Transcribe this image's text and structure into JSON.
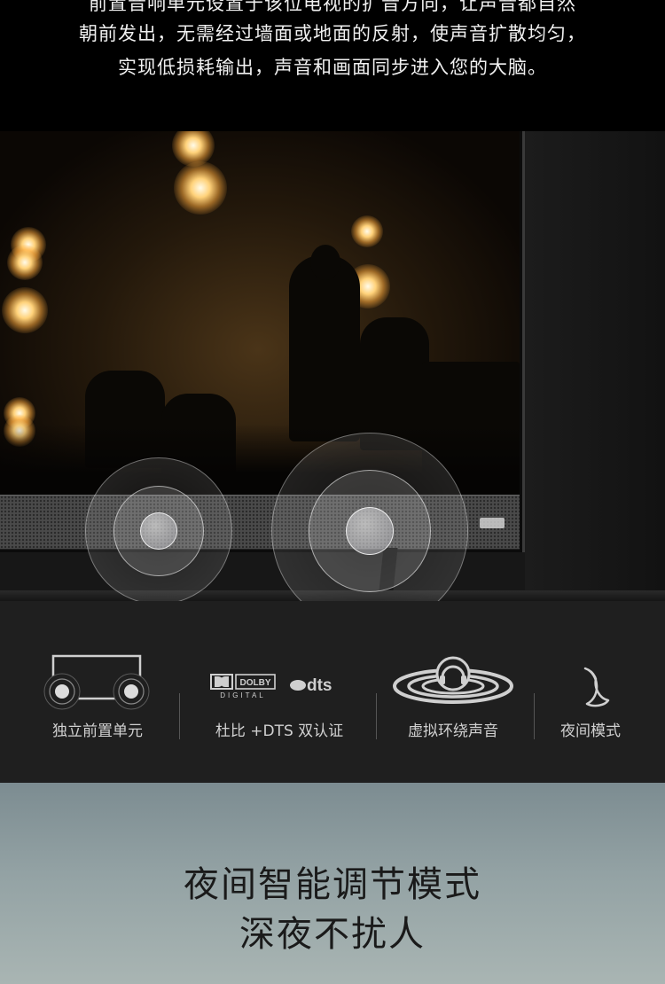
{
  "intro": {
    "lines": [
      "前置音响单元设置于该位电视的扩音方向，让声音都自然",
      "朝前发出，无需经过墙面或地面的反射，使声音扩散均匀，",
      "实现低损耗输出，声音和画面同步进入您的大脑。"
    ]
  },
  "features": [
    {
      "label": "独立前置单元",
      "icon": "front-speaker-icon"
    },
    {
      "label": "杜比 +DTS 双认证",
      "icon": "dolby-dts-logo"
    },
    {
      "label": "虚拟环绕声音",
      "icon": "surround-sound-icon"
    },
    {
      "label": "夜间模式",
      "icon": "moon-icon"
    }
  ],
  "logos": {
    "dolby_top": "DOLBY",
    "dolby_bottom": "DIGITAL",
    "dts": "dts"
  },
  "night_mode": {
    "headline_1": "夜间智能调节模式",
    "headline_2": "深夜不扰人"
  },
  "colors": {
    "background": "#000000",
    "feature_band": "#1f1f1f",
    "night_gradient_top": "#7c8c91",
    "night_gradient_bottom": "#a9b5b3",
    "stage_glow": "#ffd27a"
  }
}
